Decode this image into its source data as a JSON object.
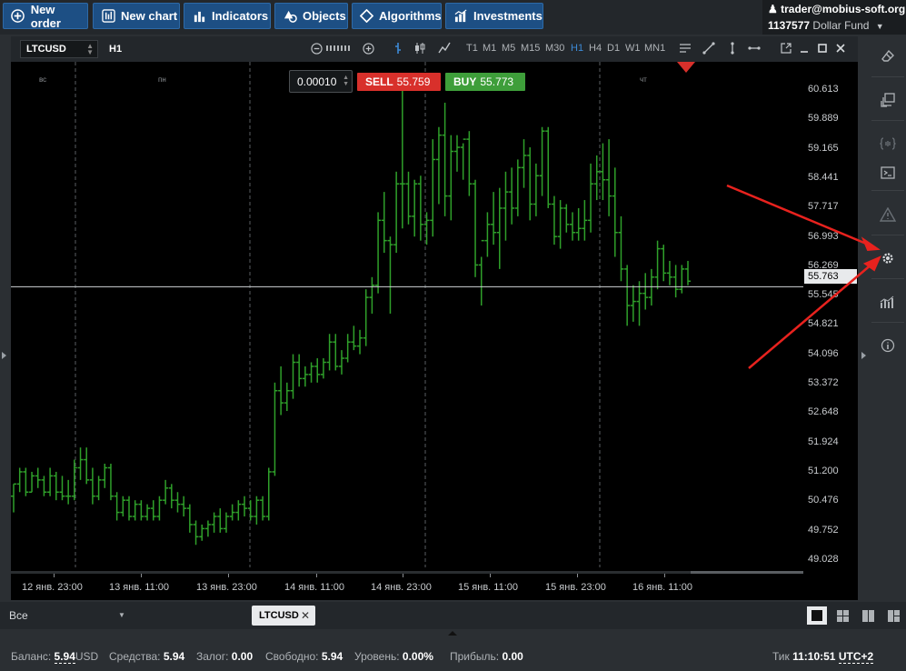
{
  "toolbar": {
    "new_order": "New order",
    "new_chart": "New chart",
    "indicators": "Indicators",
    "objects": "Objects",
    "algorithms": "Algorithms",
    "investments": "Investments"
  },
  "account": {
    "user": "trader@mobius-soft.org",
    "number": "1137577",
    "fund": "Dollar Fund"
  },
  "chart_header": {
    "symbol": "LTCUSD",
    "timeframe": "H1",
    "timeframes": [
      "T1",
      "M1",
      "M5",
      "M15",
      "M30",
      "H1",
      "H4",
      "D1",
      "W1",
      "MN1"
    ],
    "active_timeframe": "H1"
  },
  "trade": {
    "lot": "0.00010",
    "sell_label": "SELL",
    "sell_price": "55.759",
    "buy_label": "BUY",
    "buy_price": "55.773"
  },
  "chart_data": {
    "type": "ohlc",
    "symbol": "LTCUSD",
    "timeframe": "H1",
    "current_price": "55.763",
    "ylim": [
      48.7,
      61.0
    ],
    "y_ticks": [
      "60.613",
      "59.889",
      "59.165",
      "58.441",
      "57.717",
      "56.993",
      "56.269",
      "55.545",
      "54.821",
      "54.096",
      "53.372",
      "52.648",
      "51.924",
      "51.200",
      "50.476",
      "49.752",
      "49.028"
    ],
    "x_ticks": [
      "12 янв. 23:00",
      "13 янв. 11:00",
      "13 янв. 23:00",
      "14 янв. 11:00",
      "14 янв. 23:00",
      "15 янв. 11:00",
      "15 янв. 23:00",
      "16 янв. 11:00"
    ],
    "day_labels": [
      "вс",
      "пн",
      "чт"
    ],
    "bar_color": "#2fa02a",
    "candles": [
      [
        50.6,
        50.9,
        50.2,
        50.9
      ],
      [
        50.9,
        51.3,
        50.7,
        51.2
      ],
      [
        51.2,
        51.3,
        50.6,
        50.7
      ],
      [
        50.7,
        51.2,
        50.7,
        51.1
      ],
      [
        51.1,
        51.3,
        50.8,
        51.0
      ],
      [
        51.0,
        51.1,
        50.6,
        50.7
      ],
      [
        50.7,
        51.3,
        50.6,
        51.1
      ],
      [
        51.1,
        51.2,
        50.5,
        50.7
      ],
      [
        50.7,
        51.1,
        50.5,
        50.6
      ],
      [
        50.6,
        51.0,
        50.4,
        50.6
      ],
      [
        50.6,
        51.5,
        50.5,
        51.3
      ],
      [
        51.3,
        51.8,
        51.0,
        51.5
      ],
      [
        51.5,
        51.8,
        50.9,
        51.0
      ],
      [
        51.0,
        51.3,
        50.4,
        50.6
      ],
      [
        50.6,
        51.1,
        50.5,
        51.0
      ],
      [
        51.0,
        51.4,
        50.8,
        51.3
      ],
      [
        51.3,
        51.4,
        50.5,
        50.6
      ],
      [
        50.6,
        50.7,
        50.0,
        50.2
      ],
      [
        50.2,
        50.6,
        50.1,
        50.5
      ],
      [
        50.5,
        50.6,
        50.0,
        50.1
      ],
      [
        50.1,
        50.5,
        50.0,
        50.4
      ],
      [
        50.4,
        50.5,
        50.0,
        50.1
      ],
      [
        50.1,
        50.4,
        50.0,
        50.3
      ],
      [
        50.3,
        50.5,
        50.0,
        50.1
      ],
      [
        50.1,
        50.6,
        50.0,
        50.5
      ],
      [
        50.5,
        51.0,
        50.4,
        50.8
      ],
      [
        50.8,
        50.9,
        50.3,
        50.5
      ],
      [
        50.5,
        50.7,
        50.2,
        50.4
      ],
      [
        50.4,
        50.6,
        50.1,
        50.3
      ],
      [
        50.3,
        50.4,
        49.7,
        49.9
      ],
      [
        49.9,
        50.0,
        49.4,
        49.6
      ],
      [
        49.6,
        49.9,
        49.5,
        49.8
      ],
      [
        49.8,
        50.0,
        49.6,
        49.9
      ],
      [
        49.9,
        50.2,
        49.7,
        50.1
      ],
      [
        50.1,
        50.3,
        49.7,
        49.8
      ],
      [
        49.8,
        50.2,
        49.7,
        50.1
      ],
      [
        50.1,
        50.4,
        50.0,
        50.2
      ],
      [
        50.2,
        50.5,
        50.0,
        50.4
      ],
      [
        50.4,
        50.6,
        50.1,
        50.3
      ],
      [
        50.3,
        50.5,
        50.0,
        50.1
      ],
      [
        50.1,
        50.6,
        49.9,
        50.5
      ],
      [
        50.5,
        50.6,
        50.0,
        50.1
      ],
      [
        50.1,
        51.3,
        50.0,
        51.2
      ],
      [
        51.2,
        53.4,
        51.1,
        53.2
      ],
      [
        53.2,
        53.8,
        52.6,
        52.9
      ],
      [
        52.9,
        53.4,
        52.7,
        53.2
      ],
      [
        53.2,
        54.1,
        53.0,
        53.9
      ],
      [
        53.9,
        54.1,
        53.3,
        53.5
      ],
      [
        53.5,
        53.8,
        53.3,
        53.6
      ],
      [
        53.6,
        53.9,
        53.4,
        53.8
      ],
      [
        53.8,
        54.0,
        53.4,
        53.6
      ],
      [
        53.6,
        54.0,
        53.5,
        53.9
      ],
      [
        53.9,
        54.6,
        53.7,
        54.4
      ],
      [
        54.4,
        54.6,
        53.7,
        53.8
      ],
      [
        53.8,
        54.2,
        53.6,
        54.0
      ],
      [
        54.0,
        54.6,
        53.9,
        54.4
      ],
      [
        54.4,
        54.8,
        54.2,
        54.3
      ],
      [
        54.3,
        54.7,
        54.1,
        54.5
      ],
      [
        54.5,
        55.7,
        54.3,
        55.5
      ],
      [
        55.5,
        56.0,
        55.1,
        55.8
      ],
      [
        55.8,
        57.6,
        55.6,
        57.4
      ],
      [
        57.4,
        58.1,
        56.6,
        56.9
      ],
      [
        56.9,
        57.0,
        55.1,
        56.8
      ],
      [
        56.8,
        58.6,
        56.6,
        58.3
      ],
      [
        58.3,
        60.9,
        57.2,
        58.3
      ],
      [
        58.3,
        58.6,
        57.3,
        57.5
      ],
      [
        57.5,
        58.4,
        57.0,
        58.3
      ],
      [
        58.3,
        58.5,
        56.9,
        57.3
      ],
      [
        57.3,
        57.6,
        56.8,
        57.4
      ],
      [
        57.4,
        59.4,
        57.0,
        58.9
      ],
      [
        58.9,
        59.7,
        57.8,
        59.5
      ],
      [
        59.5,
        60.3,
        57.5,
        58.0
      ],
      [
        58.0,
        59.5,
        57.4,
        59.1
      ],
      [
        59.1,
        59.5,
        58.6,
        59.2
      ],
      [
        59.2,
        59.3,
        58.4,
        59.4
      ],
      [
        59.4,
        59.6,
        58.0,
        58.3
      ],
      [
        58.3,
        58.4,
        56.0,
        56.3
      ],
      [
        56.3,
        56.5,
        55.3,
        56.9
      ],
      [
        56.9,
        57.6,
        56.5,
        57.3
      ],
      [
        57.3,
        58.1,
        56.8,
        57.1
      ],
      [
        57.1,
        58.2,
        56.2,
        57.7
      ],
      [
        57.7,
        58.6,
        56.9,
        58.1
      ],
      [
        58.1,
        58.7,
        57.3,
        57.7
      ],
      [
        57.7,
        58.9,
        57.5,
        58.7
      ],
      [
        58.7,
        59.4,
        58.2,
        59.0
      ],
      [
        59.0,
        59.2,
        57.4,
        57.8
      ],
      [
        57.8,
        58.8,
        57.5,
        58.5
      ],
      [
        58.5,
        59.7,
        58.0,
        59.6
      ],
      [
        59.6,
        59.7,
        57.7,
        57.8
      ],
      [
        57.8,
        58.0,
        56.8,
        57.0
      ],
      [
        57.0,
        57.9,
        56.7,
        57.7
      ],
      [
        57.7,
        57.8,
        57.1,
        57.3
      ],
      [
        57.3,
        57.6,
        56.9,
        57.1
      ],
      [
        57.1,
        57.7,
        56.9,
        57.2
      ],
      [
        57.2,
        57.9,
        56.9,
        57.4
      ],
      [
        57.4,
        58.8,
        57.1,
        58.3
      ],
      [
        58.3,
        59.0,
        57.9,
        58.6
      ],
      [
        58.6,
        59.3,
        57.9,
        58.4
      ],
      [
        58.4,
        59.4,
        57.5,
        58.0
      ],
      [
        58.0,
        58.7,
        56.5,
        57.1
      ],
      [
        57.1,
        57.5,
        55.9,
        56.2
      ],
      [
        56.2,
        56.3,
        54.8,
        55.3
      ],
      [
        55.3,
        55.8,
        54.9,
        55.4
      ],
      [
        55.4,
        55.9,
        54.8,
        55.6
      ],
      [
        55.6,
        56.1,
        55.2,
        55.5
      ],
      [
        55.5,
        56.2,
        55.3,
        56.0
      ],
      [
        56.0,
        56.9,
        55.7,
        56.7
      ],
      [
        56.7,
        56.8,
        55.9,
        56.1
      ],
      [
        56.1,
        56.4,
        55.8,
        56.0
      ],
      [
        56.0,
        56.3,
        55.5,
        55.7
      ],
      [
        55.7,
        56.3,
        55.6,
        56.2
      ],
      [
        56.2,
        56.4,
        55.8,
        55.9
      ]
    ]
  },
  "side_panel": [
    "eraser-icon",
    "windows-icon",
    "script-icon",
    "terminal-icon",
    "warning-icon",
    "settings-icon",
    "stats-icon",
    "info-icon"
  ],
  "bottom_tabs": {
    "filter": "Все",
    "symbol_tab": "LTCUSD",
    "close": "✕"
  },
  "status": {
    "balance_label": "Баланс:",
    "balance_value": "5.94",
    "balance_currency": "USD",
    "equity_label": "Средства:",
    "equity_value": "5.94",
    "margin_label": "Залог:",
    "margin_value": "0.00",
    "free_label": "Свободно:",
    "free_value": "5.94",
    "level_label": "Уровень:",
    "level_value": "0.00%",
    "profit_label": "Прибыль:",
    "profit_value": "0.00",
    "tick_label": "Тик",
    "time": "11:10:51",
    "tz": "UTC+2"
  },
  "colors": {
    "accent": "#1d4f84",
    "sell": "#d8302b",
    "buy": "#3e9e3a",
    "annotation": "#e8221e"
  }
}
